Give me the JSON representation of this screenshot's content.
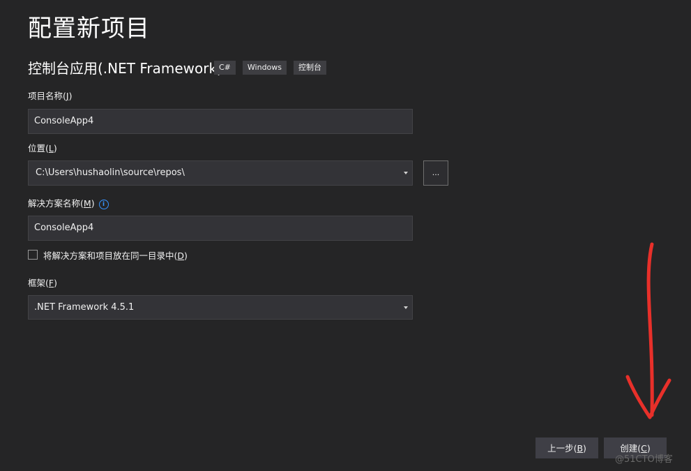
{
  "page": {
    "title": "配置新项目"
  },
  "template": {
    "name": "控制台应用(.NET Framework)",
    "tags": [
      "C#",
      "Windows",
      "控制台"
    ]
  },
  "project_name": {
    "label": "项目名称",
    "accesskey": "J",
    "value": "ConsoleApp4"
  },
  "location": {
    "label": "位置",
    "accesskey": "L",
    "value": "C:\\Users\\hushaolin\\source\\repos\\",
    "browse_label": "..."
  },
  "solution_name": {
    "label": "解决方案名称",
    "accesskey": "M",
    "value": "ConsoleApp4",
    "info_icon": "info-icon"
  },
  "same_dir": {
    "label": "将解决方案和项目放在同一目录中",
    "accesskey": "D",
    "checked": false
  },
  "framework": {
    "label": "框架",
    "accesskey": "F",
    "value": ".NET Framework 4.5.1"
  },
  "buttons": {
    "back": {
      "label": "上一步",
      "accesskey": "B"
    },
    "create": {
      "label": "创建",
      "accesskey": "C"
    }
  },
  "watermark": "@51CTO博客",
  "annotation": {
    "color": "#e8302a",
    "shape": "down-arrow"
  }
}
